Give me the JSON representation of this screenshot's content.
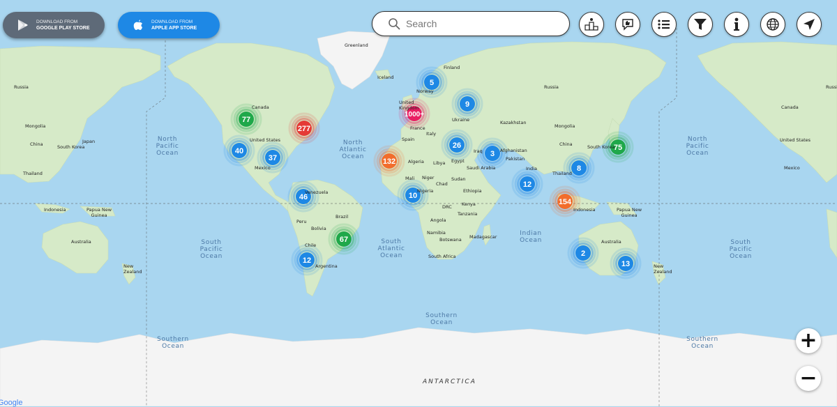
{
  "store_buttons": {
    "google": {
      "line1": "DOWNLOAD FROM",
      "line2": "GOOGLE PLAY STORE"
    },
    "apple": {
      "line1": "DOWNLOAD FROM",
      "line2": "APPLE APP STORE"
    }
  },
  "search": {
    "placeholder": "Search"
  },
  "toolbar": [
    {
      "name": "leaderboard-button",
      "icon": "podium-icon"
    },
    {
      "name": "feedback-button",
      "icon": "thumbs-up-chat-icon"
    },
    {
      "name": "list-button",
      "icon": "list-icon"
    },
    {
      "name": "filter-button",
      "icon": "filter-icon"
    },
    {
      "name": "info-button",
      "icon": "info-icon"
    },
    {
      "name": "globe-button",
      "icon": "globe-icon"
    },
    {
      "name": "locate-button",
      "icon": "navigation-arrow-icon"
    }
  ],
  "oceans": {
    "north_pacific_left": [
      "North",
      "Pacific",
      "Ocean"
    ],
    "north_pacific_right": [
      "North",
      "Pacific",
      "Ocean"
    ],
    "north_atlantic": [
      "North",
      "Atlantic",
      "Ocean"
    ],
    "south_pacific_left": [
      "South",
      "Pacific",
      "Ocean"
    ],
    "south_pacific_right": [
      "South",
      "Pacific",
      "Ocean"
    ],
    "south_atlantic": [
      "South",
      "Atlantic",
      "Ocean"
    ],
    "indian": [
      "Indian",
      "Ocean"
    ],
    "southern_center": [
      "Southern",
      "Ocean"
    ],
    "southern_left": [
      "Southern",
      "Ocean"
    ],
    "southern_right": [
      "Southern",
      "Ocean"
    ],
    "antarctica": "ANTARCTICA"
  },
  "places": {
    "greenland": "Greenland",
    "iceland": "Iceland",
    "finland": "Finland",
    "russia_left": "Russia",
    "russia_center": "Russia",
    "russia_right": "Russia",
    "canada": "Canada",
    "canada_right": "Canada",
    "united_states": "United States",
    "united_states_right": "United States",
    "mexico": "Mexico",
    "mexico_right": "Mexico",
    "mongolia_left": "Mongolia",
    "mongolia": "Mongolia",
    "china_left": "China",
    "china": "China",
    "japan_left": "Japan",
    "south_korea_left": "South Korea",
    "south_korea": "South Korea",
    "thailand_left": "Thailand",
    "thailand": "Thailand",
    "indonesia_left": "Indonesia",
    "indonesia": "Indonesia",
    "papua_left": [
      "Papua New",
      "Guinea"
    ],
    "papua": [
      "Papua New",
      "Guinea"
    ],
    "australia_left": "Australia",
    "australia": "Australia",
    "new_zealand_left": [
      "New",
      "Zealand"
    ],
    "new_zealand": [
      "New",
      "Zealand"
    ],
    "kazakhstan": "Kazakhstan",
    "afghanistan": "Afghanistan",
    "pakistan": "Pakistan",
    "india": "India",
    "iraq": "Iraq",
    "saudi_arabia": "Saudi Arabia",
    "egypt": "Egypt",
    "libya": "Libya",
    "algeria": "Algeria",
    "mali": "Mali",
    "niger": "Niger",
    "chad": "Chad",
    "sudan": "Sudan",
    "ethiopia": "Ethiopia",
    "nigeria": "Nigeria",
    "kenya": "Kenya",
    "drc": "DRC",
    "tanzania": "Tanzania",
    "angola": "Angola",
    "namibia": "Namibia",
    "botswana": "Botswana",
    "madagascar": "Madagascar",
    "south_africa": "South Africa",
    "spain": "Spain",
    "france": "France",
    "italy": "Italy",
    "norway": "Norway",
    "ukraine": "Ukraine",
    "united_kingdom": [
      "United",
      "Kingdom"
    ],
    "venezuela": "Venezuela",
    "peru": "Peru",
    "brazil": "Brazil",
    "bolivia": "Bolivia",
    "chile": "Chile",
    "argentina": "Argentina"
  },
  "clusters": [
    {
      "label": "5",
      "color": "#1e88e5"
    },
    {
      "label": "1000+",
      "color": "#e91e63"
    },
    {
      "label": "9",
      "color": "#1e88e5"
    },
    {
      "label": "77",
      "color": "#1fa84a"
    },
    {
      "label": "277",
      "color": "#e53935"
    },
    {
      "label": "40",
      "color": "#1e88e5"
    },
    {
      "label": "37",
      "color": "#1e88e5"
    },
    {
      "label": "26",
      "color": "#1e88e5"
    },
    {
      "label": "3",
      "color": "#1e88e5"
    },
    {
      "label": "132",
      "color": "#f26d2c"
    },
    {
      "label": "75",
      "color": "#1fa84a"
    },
    {
      "label": "8",
      "color": "#1e88e5"
    },
    {
      "label": "12",
      "color": "#1e88e5"
    },
    {
      "label": "154",
      "color": "#f26d2c"
    },
    {
      "label": "46",
      "color": "#1e88e5"
    },
    {
      "label": "10",
      "color": "#1e88e5"
    },
    {
      "label": "67",
      "color": "#1fa84a"
    },
    {
      "label": "12",
      "color": "#1e88e5"
    },
    {
      "label": "2",
      "color": "#1e88e5"
    },
    {
      "label": "13",
      "color": "#1e88e5"
    }
  ],
  "zoom": {
    "in": "+",
    "out": "−"
  },
  "attribution": "Google",
  "colors": {
    "water": "#a9d6f0",
    "land": "#d7ebcb",
    "ice": "#f4f4f4",
    "apple_button": "#1e88e5",
    "google_button": "#5e6a78"
  }
}
